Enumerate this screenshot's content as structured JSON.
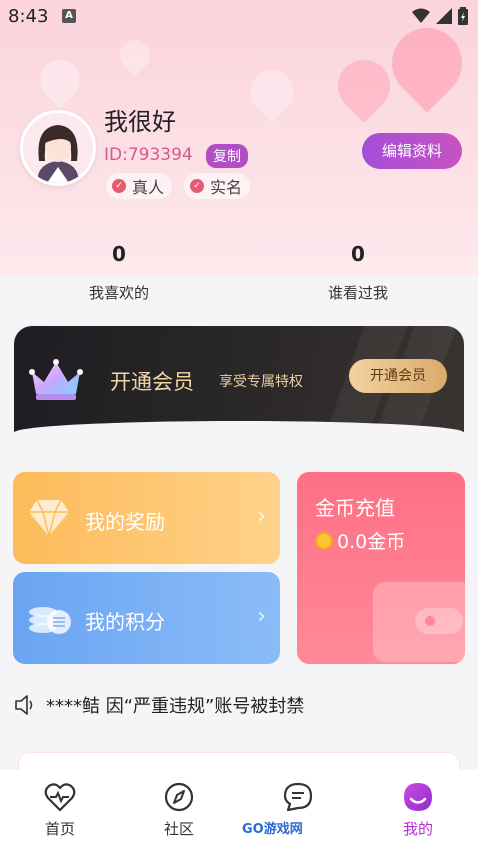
{
  "status_bar": {
    "time": "8:43",
    "notification_icon": "A"
  },
  "profile": {
    "name": "我很好",
    "id_text": "ID:793394",
    "copy_label": "复制",
    "tags": [
      "真人",
      "实名"
    ],
    "edit_label": "编辑资料"
  },
  "stats": [
    {
      "value": "0",
      "label": "我喜欢的"
    },
    {
      "value": "0",
      "label": "谁看过我"
    }
  ],
  "vip": {
    "title": "开通会员",
    "subtitle": "享受专属特权",
    "button": "开通会员"
  },
  "cards": {
    "reward": "我的奖励",
    "points": "我的积分",
    "recharge_title": "金币充值",
    "recharge_amount": "0.0金币"
  },
  "notice": "****鲒 因“严重违规”账号被封禁",
  "tabs": [
    {
      "label": "首页",
      "icon": "heart-pulse-icon"
    },
    {
      "label": "社区",
      "icon": "compass-icon"
    },
    {
      "label": "",
      "icon": "chat-icon"
    },
    {
      "label": "我的",
      "icon": "profile-icon"
    }
  ],
  "watermark": "GO游戏网",
  "colors": {
    "accent": "#b031d0",
    "vip_gold": "#f2d7a6",
    "reward": "#fdbb59",
    "points": "#6aa4f2",
    "recharge": "#ff6f85"
  }
}
